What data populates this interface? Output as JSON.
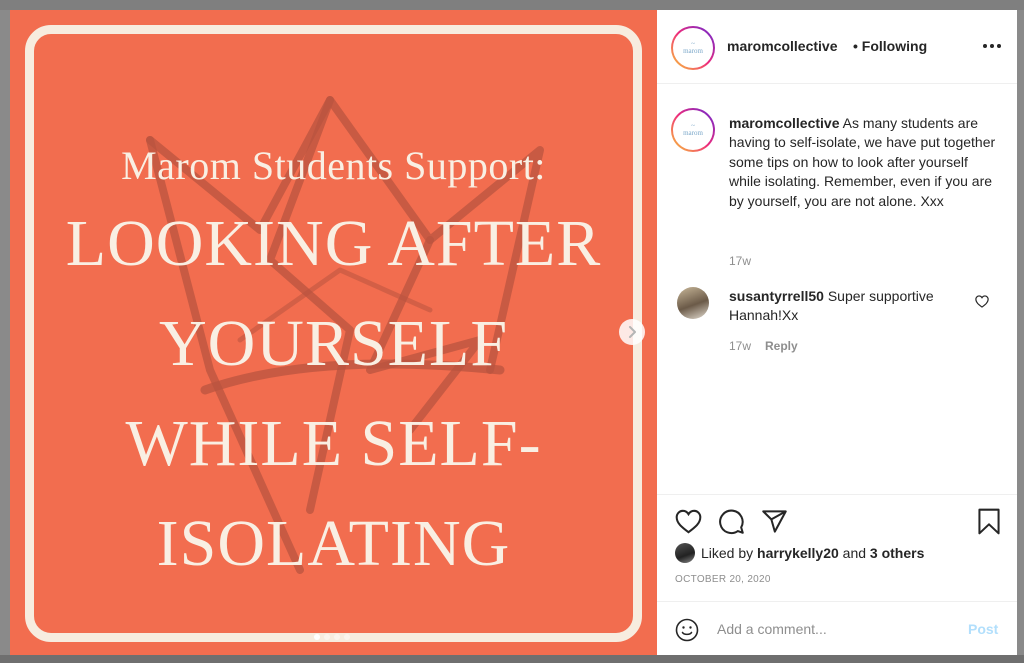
{
  "post": {
    "image": {
      "subtitle": "Marom Students Support:",
      "title_lines": [
        "LOOKING AFTER",
        "YOURSELF",
        "WHILE SELF-",
        "ISOLATING"
      ],
      "background_color": "#f26d4f",
      "frame_color": "#f7ecdf",
      "carousel_dots": 4,
      "active_dot": 0,
      "next_icon": "chevron-right-icon"
    },
    "header": {
      "username": "maromcollective",
      "separator": "•",
      "following_label": "Following",
      "more_icon": "more-horizontal-icon"
    },
    "caption": {
      "username": "maromcollective",
      "text": "As many students are having to self-isolate, we have put together some tips on how to look after yourself while isolating. Remember, even if you are by yourself, you are not alone. Xxx",
      "time": "17w"
    },
    "comments": [
      {
        "username": "susantyrrell50",
        "text": "Super supportive Hannah!Xx",
        "time": "17w",
        "reply_label": "Reply"
      }
    ],
    "actions": {
      "icons": [
        "heart-icon",
        "comment-icon",
        "share-icon",
        "bookmark-icon"
      ],
      "liked_prefix": "Liked by",
      "liked_user": "harrykelly20",
      "liked_and": "and",
      "liked_others": "3 others",
      "date": "OCTOBER 20, 2020"
    },
    "add_comment": {
      "placeholder": "Add a comment...",
      "post_label": "Post",
      "post_color": "#b2dffc"
    }
  }
}
